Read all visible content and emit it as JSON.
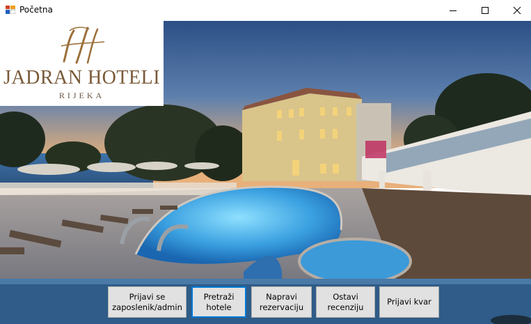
{
  "window": {
    "title": "Početna"
  },
  "logo": {
    "name": "JADRAN HOTELI",
    "city": "RIJEKA"
  },
  "buttons": [
    {
      "label": "Prijavi se\nzaposlenik/admin"
    },
    {
      "label": "Pretraži\nhotele"
    },
    {
      "label": "Napravi\nrezervaciju"
    },
    {
      "label": "Ostavi\nrecenziju"
    },
    {
      "label": "Prijavi kvar"
    }
  ],
  "colors": {
    "sky_top": "#2c4f86",
    "sky_horizon": "#e8b07a",
    "pool": "#3aa0e0",
    "building": "#d9c48a",
    "focus": "#0078d7"
  }
}
